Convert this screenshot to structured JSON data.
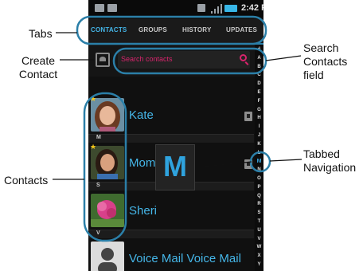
{
  "statusbar": {
    "time": "2:42 PM"
  },
  "tabs": [
    {
      "label": "CONTACTS",
      "active": true
    },
    {
      "label": "GROUPS",
      "active": false
    },
    {
      "label": "HISTORY",
      "active": false
    },
    {
      "label": "UPDATES",
      "active": false
    }
  ],
  "search": {
    "placeholder": "Search contacts"
  },
  "contacts": [
    {
      "section": "K",
      "name": "Kate",
      "favorite": true
    },
    {
      "section": "M",
      "name": "Mom",
      "favorite": true
    },
    {
      "section": "S",
      "name": "Sheri",
      "favorite": false
    },
    {
      "section": "V",
      "name": "Voice Mail Voice Mail",
      "favorite": false
    }
  ],
  "index_letters": [
    "#",
    "A",
    "B",
    "C",
    "D",
    "E",
    "F",
    "G",
    "H",
    "I",
    "J",
    "K",
    "L",
    "M",
    "N",
    "O",
    "P",
    "Q",
    "R",
    "S",
    "T",
    "U",
    "V",
    "W",
    "X",
    "Y"
  ],
  "active_index_letter": "M",
  "popup_letter": "M",
  "callouts": {
    "tabs": "Tabs",
    "create_contact": "Create Contact",
    "contacts": "Contacts",
    "search_field": "Search Contacts field",
    "tabbed_navigation": "Tabbed Navigation"
  },
  "colors": {
    "accent": "#44b4e6",
    "search_text": "#d8246c",
    "callout_outline": "#2b7fa8"
  }
}
